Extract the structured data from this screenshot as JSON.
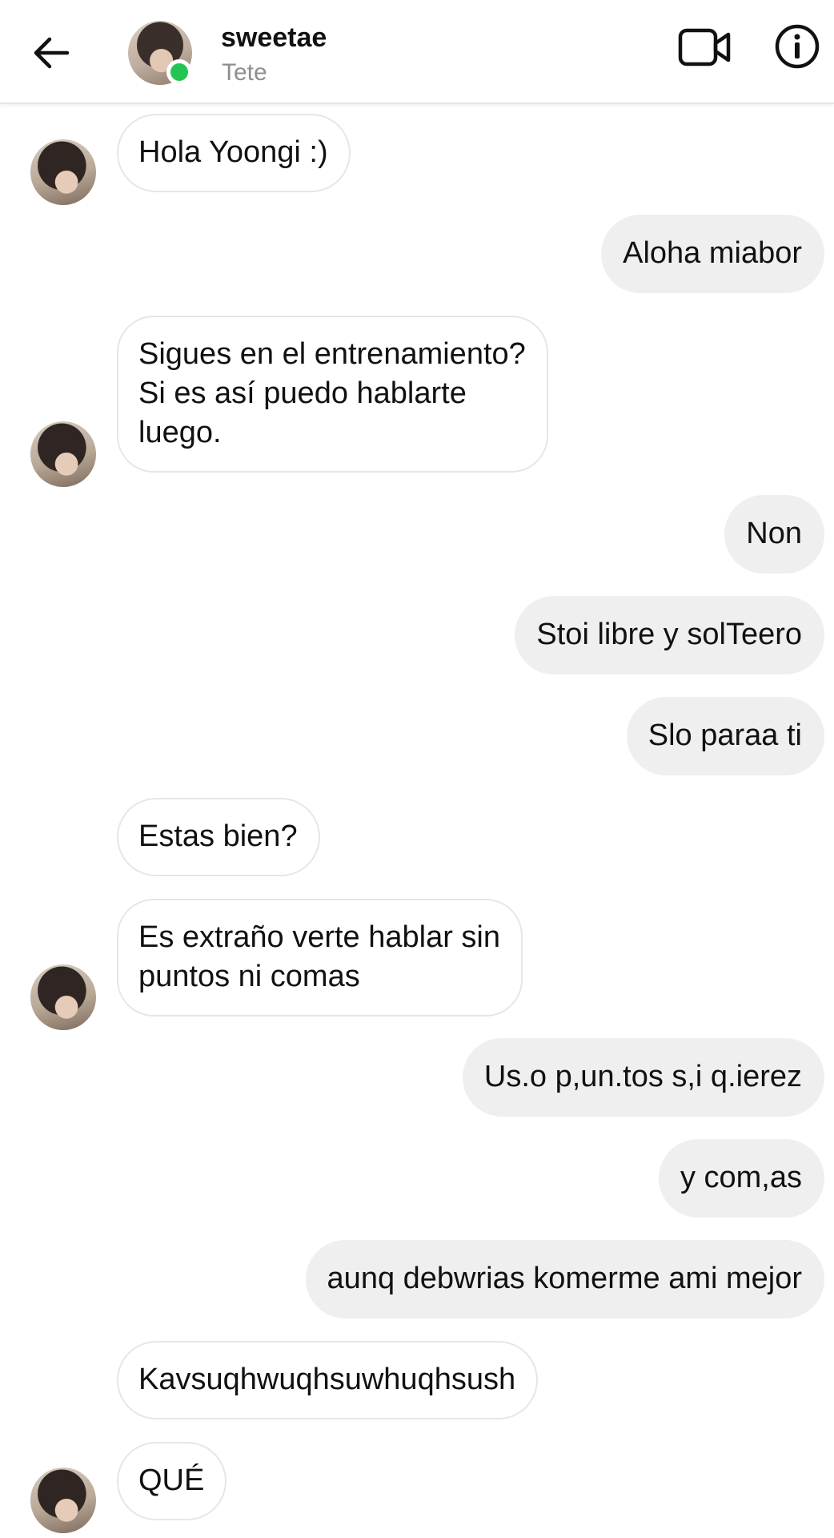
{
  "header": {
    "back_icon": "arrow-left-icon",
    "contact_name": "sweetae",
    "contact_subtitle": "Tete",
    "online_color": "#23c552",
    "video_icon": "video-camera-icon",
    "info_icon": "info-circle-icon"
  },
  "messages": [
    {
      "side": "in",
      "text": "Hola Yoongi :)"
    },
    {
      "side": "out",
      "text": "Aloha miabor"
    },
    {
      "side": "in",
      "text": "Sigues en el entrenamiento?\nSi es así puedo hablarte\nluego."
    },
    {
      "side": "out",
      "text": "Non"
    },
    {
      "side": "out",
      "text": "Stoi libre y solTeero"
    },
    {
      "side": "out",
      "text": "Slo paraa ti"
    },
    {
      "side": "in",
      "text": "Estas bien?"
    },
    {
      "side": "in",
      "text": "Es extraño verte hablar sin\npuntos ni comas"
    },
    {
      "side": "out",
      "text": "Us.o p,un.tos s,i q.ierez"
    },
    {
      "side": "out",
      "text": "y com,as"
    },
    {
      "side": "out",
      "text": "aunq debwrias komerme ami mejor"
    },
    {
      "side": "in",
      "text": "Kavsuqhwuqhsuwhuqhsush"
    },
    {
      "side": "in",
      "text": "QUÉ"
    }
  ],
  "colors": {
    "outgoing_bubble": "#efefef",
    "incoming_border": "#e6e6e6",
    "subtitle": "#8e8e8e"
  }
}
